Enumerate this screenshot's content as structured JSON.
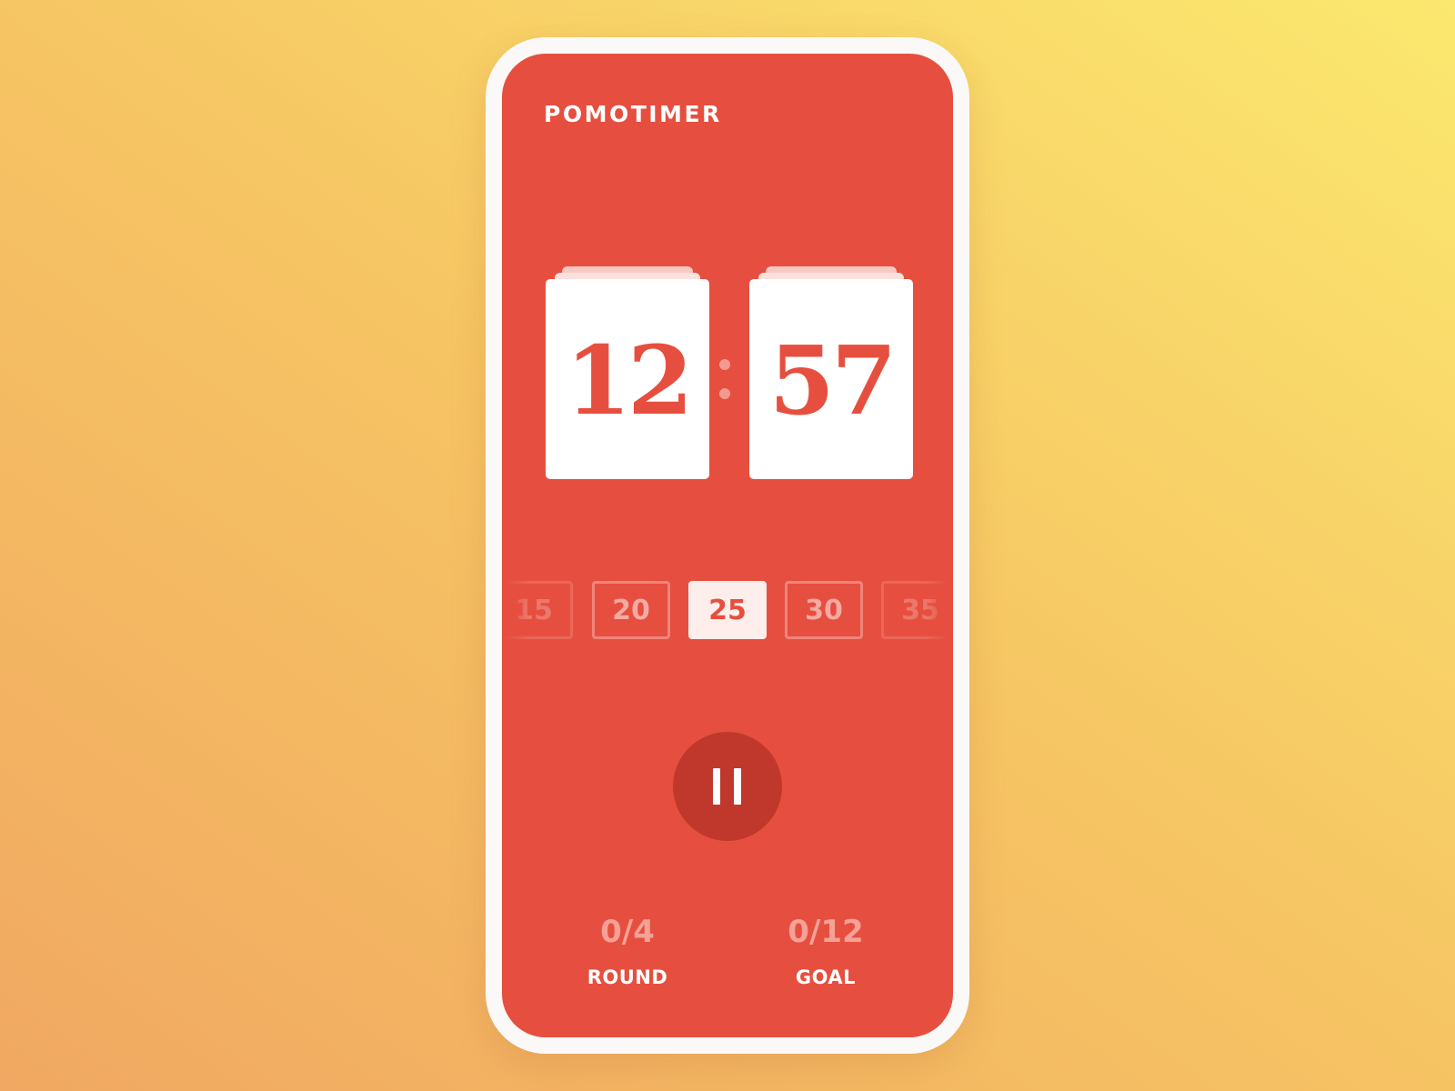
{
  "app": {
    "title": "POMOTIMER"
  },
  "timer": {
    "minutes": "12",
    "seconds": "57"
  },
  "duration_picker": {
    "options": [
      "15",
      "20",
      "25",
      "30",
      "35"
    ],
    "selected": "25"
  },
  "controls": {
    "pause_icon": "pause-icon"
  },
  "stats": {
    "round": {
      "value": "0/4",
      "label": "ROUND"
    },
    "goal": {
      "value": "0/12",
      "label": "GOAL"
    }
  },
  "colors": {
    "accent": "#e64f3f",
    "pause_button": "#c0382b",
    "background_gradient": [
      "#f1a862",
      "#fbe86f"
    ]
  }
}
